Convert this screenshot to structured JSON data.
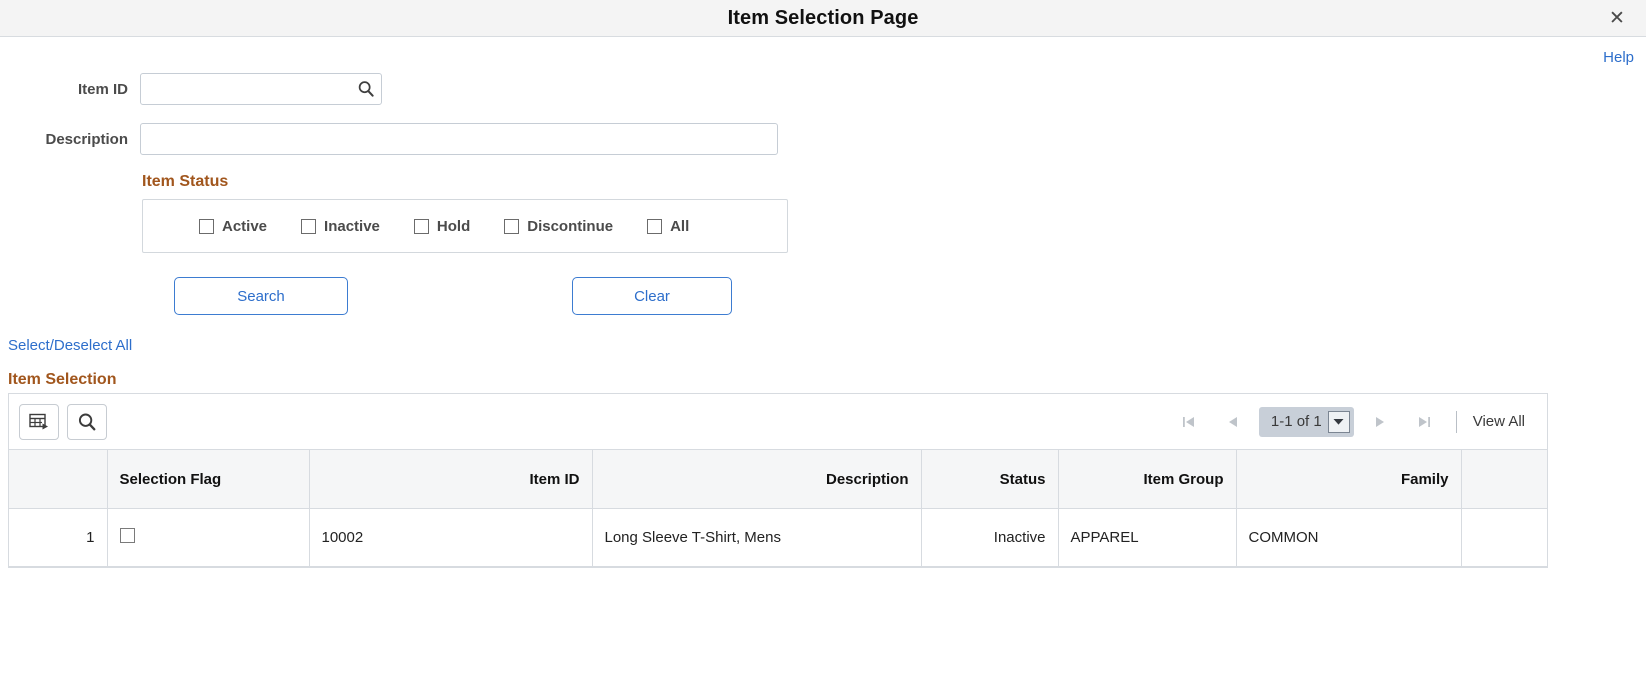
{
  "window": {
    "title": "Item Selection Page",
    "close_label": "✕",
    "close_icon": "close-icon"
  },
  "help": {
    "label": "Help"
  },
  "search_form": {
    "item_id": {
      "label": "Item ID",
      "value": "",
      "placeholder": "",
      "lookup_icon": "search-icon"
    },
    "description": {
      "label": "Description",
      "value": "",
      "placeholder": ""
    },
    "item_status": {
      "title": "Item Status",
      "options": [
        {
          "label": "Active",
          "checked": false
        },
        {
          "label": "Inactive",
          "checked": false
        },
        {
          "label": "Hold",
          "checked": false
        },
        {
          "label": "Discontinue",
          "checked": false
        },
        {
          "label": "All",
          "checked": false
        }
      ]
    },
    "buttons": {
      "search": "Search",
      "clear": "Clear"
    }
  },
  "select_all_link": "Select/Deselect All",
  "grid": {
    "title": "Item Selection",
    "toolbar": {
      "personalize_icon": "grid-personalize-icon",
      "find_icon": "search-icon",
      "first_icon": "first-page-icon",
      "prev_icon": "previous-page-icon",
      "counter": "1-1 of 1",
      "counter_dropdown_icon": "chevron-down-icon",
      "next_icon": "next-page-icon",
      "last_icon": "last-page-icon",
      "view_all": "View All"
    },
    "columns": [
      {
        "label": "",
        "align": "right"
      },
      {
        "label": "Selection Flag",
        "align": "left"
      },
      {
        "label": "Item ID",
        "align": "right"
      },
      {
        "label": "Description",
        "align": "right"
      },
      {
        "label": "Status",
        "align": "right"
      },
      {
        "label": "Item Group",
        "align": "right"
      },
      {
        "label": "Family",
        "align": "right"
      },
      {
        "label": "",
        "align": "left"
      }
    ],
    "rows": [
      {
        "num": "1",
        "selected": false,
        "item_id": "10002",
        "description": "Long Sleeve T-Shirt, Mens",
        "status": "Inactive",
        "item_group": "APPAREL",
        "family": "COMMON",
        "extra": ""
      }
    ]
  },
  "colors": {
    "accent_heading": "#a1561d",
    "link_blue": "#2d6ecb",
    "titlebar_bg": "#f4f4f4",
    "grid_header_bg": "#f5f6f7",
    "counter_bg": "#c8cfd8"
  }
}
